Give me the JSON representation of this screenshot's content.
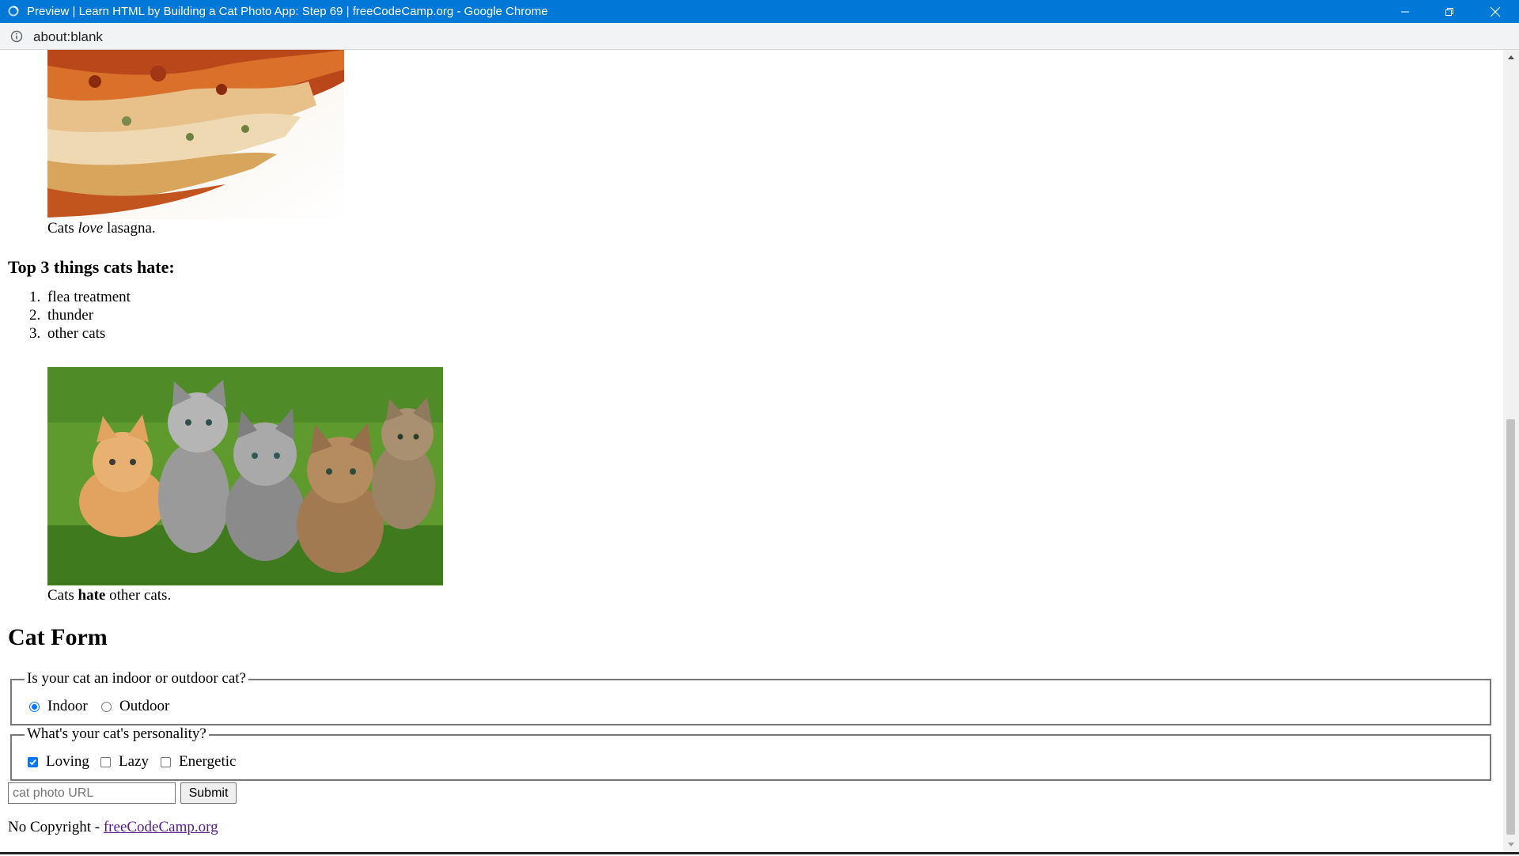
{
  "window": {
    "title": "Preview | Learn HTML by Building a Cat Photo App: Step 69 | freeCodeCamp.org - Google Chrome",
    "title_bar_color": "#0078d7"
  },
  "address_bar": {
    "url": "about:blank",
    "icon": "info-icon"
  },
  "page": {
    "lasagna_figure": {
      "image_alt": "lasagna",
      "caption_before": "Cats ",
      "caption_em": "love",
      "caption_after": " lasagna."
    },
    "hate_heading": "Top 3 things cats hate:",
    "hate_items": [
      {
        "num": "1.",
        "text": "flea treatment"
      },
      {
        "num": "2.",
        "text": "thunder"
      },
      {
        "num": "3.",
        "text": "other cats"
      }
    ],
    "kittens_figure": {
      "image_alt": "five kittens on grass",
      "caption_before": "Cats ",
      "caption_strong": "hate",
      "caption_after": " other cats."
    },
    "form_heading": "Cat Form",
    "indoor_fieldset": {
      "legend": "Is your cat an indoor or outdoor cat?",
      "options": [
        {
          "label": "Indoor",
          "checked": true
        },
        {
          "label": "Outdoor",
          "checked": false
        }
      ]
    },
    "personality_fieldset": {
      "legend": "What's your cat's personality?",
      "options": [
        {
          "label": "Loving",
          "checked": true
        },
        {
          "label": "Lazy",
          "checked": false
        },
        {
          "label": "Energetic",
          "checked": false
        }
      ]
    },
    "url_input": {
      "placeholder": "cat photo URL",
      "value": ""
    },
    "submit_label": "Submit",
    "footer": {
      "text": "No Copyright - ",
      "link": "freeCodeCamp.org"
    }
  },
  "colors": {
    "accent": "#0075ff",
    "link_visited": "#551a8b"
  }
}
